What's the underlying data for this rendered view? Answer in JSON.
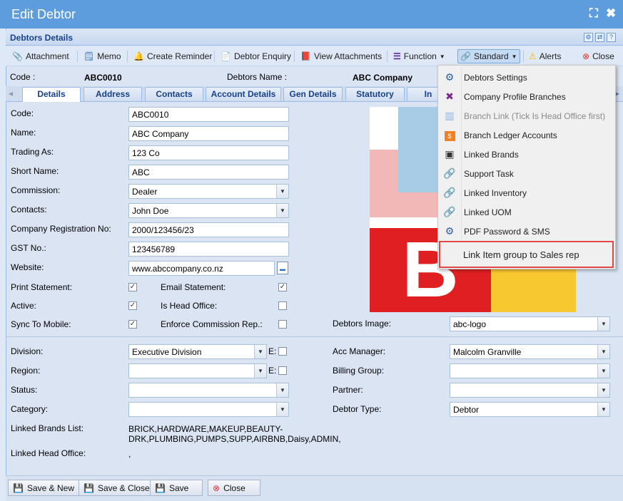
{
  "window": {
    "title": "Edit Debtor",
    "panel_title": "Debtors Details"
  },
  "toolbar": [
    {
      "label": "Attachment",
      "icon": "paperclip-icon"
    },
    {
      "label": "Memo",
      "icon": "memo-icon"
    },
    {
      "label": "Create Reminder",
      "icon": "bell-icon"
    },
    {
      "label": "Debtor Enquiry",
      "icon": "document-icon"
    },
    {
      "label": "View Attachments",
      "icon": "attachments-icon"
    },
    {
      "label": "Function",
      "icon": "list-icon"
    },
    {
      "label": "Standard",
      "icon": "link-icon"
    },
    {
      "label": "Alerts",
      "icon": "warning-icon"
    },
    {
      "label": "Close",
      "icon": "close-icon"
    }
  ],
  "header": {
    "code_label": "Code :",
    "code": "ABC0010",
    "name_label": "Debtors Name :",
    "name": "ABC Company"
  },
  "tabs": [
    "Details",
    "Address",
    "Contacts",
    "Account Details",
    "Gen Details",
    "Statutory",
    "In"
  ],
  "form": {
    "code_label": "Code:",
    "code": "ABC0010",
    "name_label": "Name:",
    "name": "ABC Company",
    "trading_label": "Trading As:",
    "trading": "123 Co",
    "short_label": "Short Name:",
    "short": "ABC",
    "commission_label": "Commission:",
    "commission": "Dealer",
    "contacts_label": "Contacts:",
    "contacts": "John Doe",
    "reg_label": "Company Registration No:",
    "reg": "2000/123456/23",
    "gst_label": "GST No.:",
    "gst": "123456789",
    "website_label": "Website:",
    "website": "www.abccompany.co.nz",
    "print_label": "Print Statement:",
    "email_label": "Email Statement:",
    "active_label": "Active:",
    "headoffice_label": "Is Head Office:",
    "sync_label": "Sync To Mobile:",
    "enforce_label": "Enforce Commission Rep.:",
    "image_label": "Debtors Image:",
    "image": "abc-logo",
    "checks": {
      "print": true,
      "email": true,
      "active": true,
      "headoffice": false,
      "sync": true,
      "enforce": false
    }
  },
  "lower": {
    "division_label": "Division:",
    "division": "Executive Division",
    "e_label": "E:",
    "region_label": "Region:",
    "region": "",
    "status_label": "Status:",
    "status": "",
    "category_label": "Category:",
    "category": "",
    "accmgr_label": "Acc Manager:",
    "accmgr": "Malcolm Granville",
    "billing_label": "Billing Group:",
    "billing": "",
    "partner_label": "Partner:",
    "partner": "",
    "type_label": "Debtor Type:",
    "type": "Debtor",
    "brands_label": "Linked Brands List:",
    "brands_line1": "BRICK,HARDWARE,MAKEUP,BEAUTY-",
    "brands_line2": "DRK,PLUMBING,PUMPS,SUPP,AIRBNB,Daisy,ADMIN,",
    "headoffice_label": "Linked Head Office:",
    "headoffice": ","
  },
  "menu": [
    {
      "label": "Debtors Settings",
      "icon": "gear-icon"
    },
    {
      "label": "Company Profile Branches",
      "icon": "branches-icon"
    },
    {
      "label": "Branch Link (Tick Is Head Office first)",
      "icon": "building-icon",
      "disabled": true
    },
    {
      "label": "Branch Ledger Accounts",
      "icon": "ledger-icon"
    },
    {
      "label": "Linked Brands",
      "icon": "window-icon"
    },
    {
      "label": "Support Task",
      "icon": "link-icon"
    },
    {
      "label": "Linked Inventory",
      "icon": "link-icon"
    },
    {
      "label": "Linked UOM",
      "icon": "link-icon"
    },
    {
      "label": "PDF Password & SMS",
      "icon": "gear-icon"
    },
    {
      "label": "Link Item group to Sales rep"
    }
  ],
  "footer": [
    "Save & New",
    "Save & Close",
    "Save",
    "Close"
  ]
}
